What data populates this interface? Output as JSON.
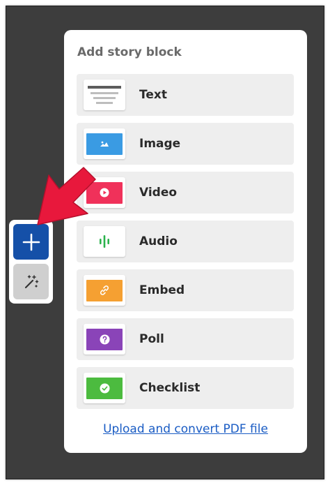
{
  "panel": {
    "title": "Add story block",
    "blocks": [
      {
        "label": "Text",
        "icon": "text-lines-icon"
      },
      {
        "label": "Image",
        "icon": "image-icon",
        "color": "#3a9be3"
      },
      {
        "label": "Video",
        "icon": "play-icon",
        "color": "#f0315a"
      },
      {
        "label": "Audio",
        "icon": "audio-wave-icon",
        "color": "#2bb24c"
      },
      {
        "label": "Embed",
        "icon": "link-icon",
        "color": "#f5a032"
      },
      {
        "label": "Poll",
        "icon": "question-icon",
        "color": "#8a44b8"
      },
      {
        "label": "Checklist",
        "icon": "check-icon",
        "color": "#4cbb3f"
      }
    ],
    "upload_link": "Upload and convert PDF file"
  },
  "toolbar": {
    "add_icon": "plus-icon",
    "magic_icon": "magic-wand-icon"
  },
  "colors": {
    "background": "#3d3d3d",
    "add_button": "#1550a8",
    "magic_button": "#cfcfcf",
    "arrow": "#e8183c",
    "link": "#1a5cc4"
  }
}
